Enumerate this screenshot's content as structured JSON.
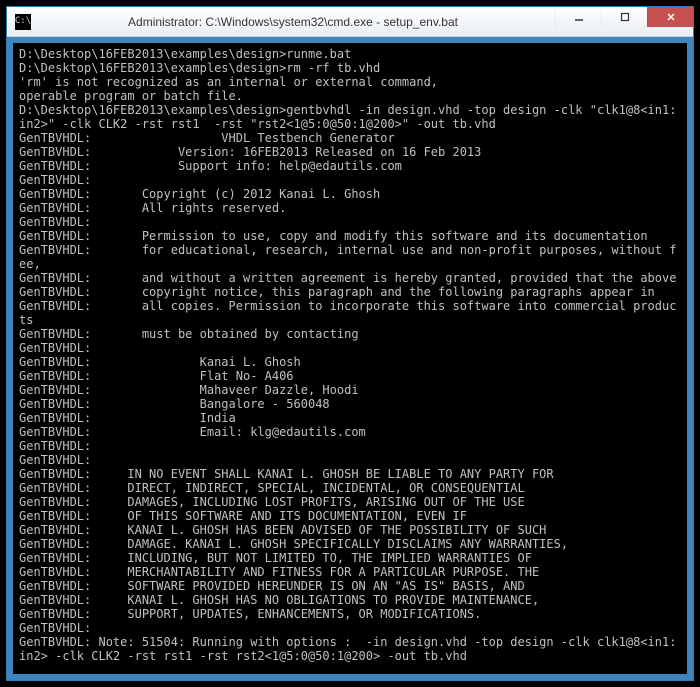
{
  "titlebar": {
    "icon_glyph": "C:\\",
    "title": "Administrator: C:\\Windows\\system32\\cmd.exe - setup_env.bat"
  },
  "console": {
    "lines": [
      "D:\\Desktop\\16FEB2013\\examples\\design>runme.bat",
      "",
      "D:\\Desktop\\16FEB2013\\examples\\design>rm -rf tb.vhd",
      "'rm' is not recognized as an internal or external command,",
      "operable program or batch file.",
      "",
      "D:\\Desktop\\16FEB2013\\examples\\design>gentbvhdl -in design.vhd -top design -clk \"clk1@8<in1:in2>\" -clk CLK2 -rst rst1  -rst \"rst2<1@5:0@50:1@200>\" -out tb.vhd",
      "GenTBVHDL:                  VHDL Testbench Generator",
      "GenTBVHDL:            Version: 16FEB2013 Released on 16 Feb 2013",
      "GenTBVHDL:            Support info: help@edautils.com",
      "GenTBVHDL:",
      "GenTBVHDL:       Copyright (c) 2012 Kanai L. Ghosh",
      "GenTBVHDL:       All rights reserved.",
      "GenTBVHDL:",
      "GenTBVHDL:       Permission to use, copy and modify this software and its documentation",
      "GenTBVHDL:       for educational, research, internal use and non-profit purposes, without fee,",
      "GenTBVHDL:       and without a written agreement is hereby granted, provided that the above",
      "GenTBVHDL:       copyright notice, this paragraph and the following paragraphs appear in",
      "GenTBVHDL:       all copies. Permission to incorporate this software into commercial products",
      "GenTBVHDL:       must be obtained by contacting",
      "GenTBVHDL:",
      "GenTBVHDL:               Kanai L. Ghosh",
      "GenTBVHDL:               Flat No- A406",
      "GenTBVHDL:               Mahaveer Dazzle, Hoodi",
      "GenTBVHDL:               Bangalore - 560048",
      "GenTBVHDL:               India",
      "GenTBVHDL:               Email: klg@edautils.com",
      "GenTBVHDL:",
      "GenTBVHDL:",
      "GenTBVHDL:     IN NO EVENT SHALL KANAI L. GHOSH BE LIABLE TO ANY PARTY FOR",
      "GenTBVHDL:     DIRECT, INDIRECT, SPECIAL, INCIDENTAL, OR CONSEQUENTIAL",
      "GenTBVHDL:     DAMAGES, INCLUDING LOST PROFITS, ARISING OUT OF THE USE",
      "GenTBVHDL:     OF THIS SOFTWARE AND ITS DOCUMENTATION, EVEN IF",
      "GenTBVHDL:     KANAI L. GHOSH HAS BEEN ADVISED OF THE POSSIBILITY OF SUCH",
      "GenTBVHDL:     DAMAGE. KANAI L. GHOSH SPECIFICALLY DISCLAIMS ANY WARRANTIES,",
      "GenTBVHDL:     INCLUDING, BUT NOT LIMITED TO, THE IMPLIED WARRANTIES OF",
      "GenTBVHDL:     MERCHANTABILITY AND FITNESS FOR A PARTICULAR PURPOSE. THE",
      "GenTBVHDL:     SOFTWARE PROVIDED HEREUNDER IS ON AN \"AS IS\" BASIS, AND",
      "GenTBVHDL:     KANAI L. GHOSH HAS NO OBLIGATIONS TO PROVIDE MAINTENANCE,",
      "GenTBVHDL:     SUPPORT, UPDATES, ENHANCEMENTS, OR MODIFICATIONS.",
      "GenTBVHDL:",
      "",
      "GenTBVHDL: Note: 51504: Running with options :  -in design.vhd -top design -clk clk1@8<in1:in2> -clk CLK2 -rst rst1 -rst rst2<1@5:0@50:1@200> -out tb.vhd"
    ]
  }
}
